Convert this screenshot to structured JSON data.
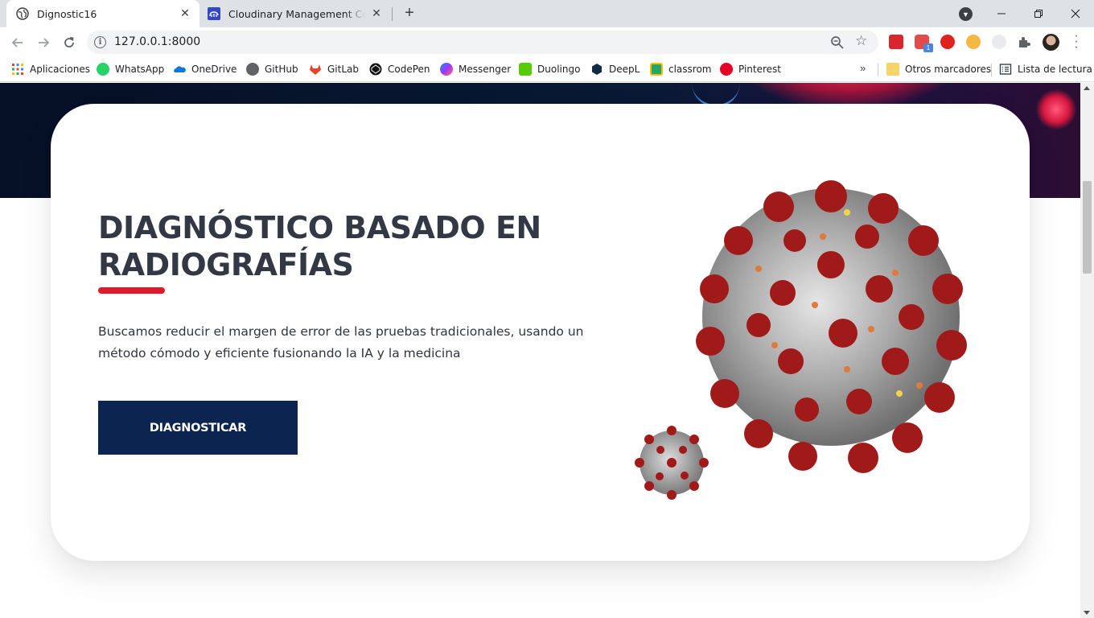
{
  "browser": {
    "tabs": [
      {
        "title": "Dignostic16",
        "active": true
      },
      {
        "title": "Cloudinary Management Console",
        "active": false
      }
    ],
    "new_tab_label": "+",
    "url": "127.0.0.1:8000",
    "bookmarks": [
      {
        "label": "Aplicaciones",
        "icon": "apps-grid-icon"
      },
      {
        "label": "WhatsApp",
        "icon": "whatsapp-icon"
      },
      {
        "label": "OneDrive",
        "icon": "onedrive-icon"
      },
      {
        "label": "GitHub",
        "icon": "github-icon"
      },
      {
        "label": "GitLab",
        "icon": "gitlab-icon"
      },
      {
        "label": "CodePen",
        "icon": "codepen-icon"
      },
      {
        "label": "Messenger",
        "icon": "messenger-icon"
      },
      {
        "label": "Duolingo",
        "icon": "duolingo-icon"
      },
      {
        "label": "DeepL",
        "icon": "deepl-icon"
      },
      {
        "label": "classrom",
        "icon": "classroom-icon"
      },
      {
        "label": "Pinterest",
        "icon": "pinterest-icon"
      }
    ],
    "other_bookmarks": "Otros marcadores",
    "reading_list": "Lista de lectura",
    "extension_badge": "1"
  },
  "page": {
    "title_line1": "DIAGNÓSTICO BASADO EN",
    "title_line2": "RADIOGRAFÍAS",
    "description_line1": "Buscamos reducir el margen de error de las pruebas tradicionales, usando un",
    "description_line2": "método cómodo y eficiente fusionando la IA y la medicina",
    "cta_label": "DIAGNOSTICAR"
  },
  "colors": {
    "accent_red": "#e01a2c",
    "button_navy": "#0b2550",
    "hero_dark": "#061026",
    "title_text": "#323844"
  }
}
